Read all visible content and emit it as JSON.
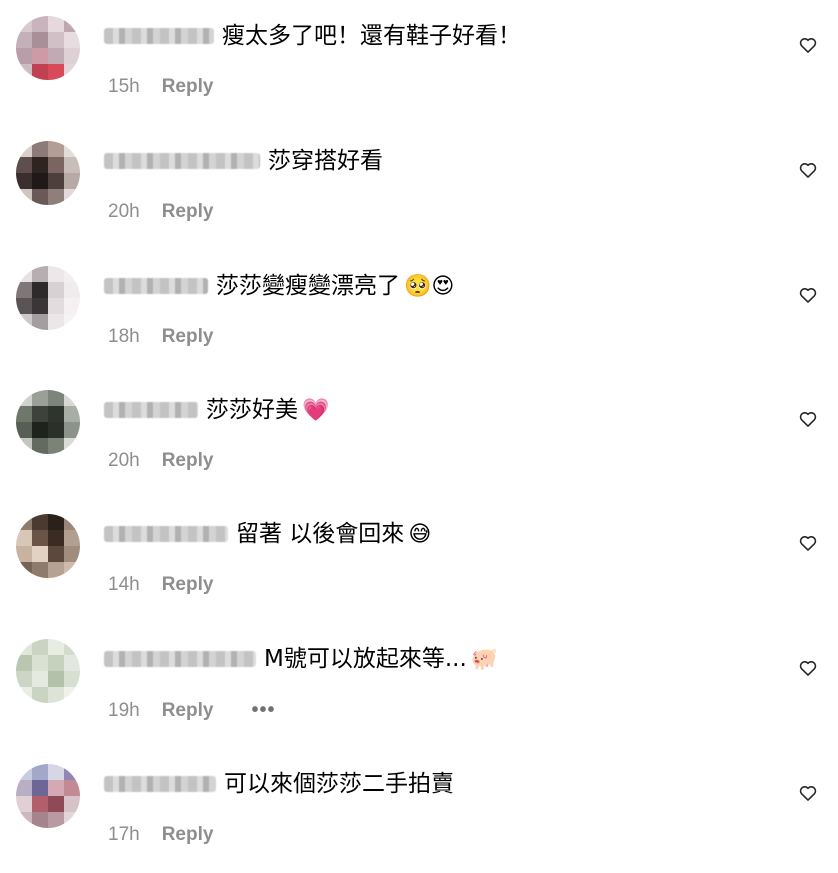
{
  "colors": {
    "text": "#000000",
    "meta": "#8e8e8e",
    "heart_stroke": "#262626"
  },
  "comments": [
    {
      "text": "瘦太多了吧！還有鞋子好看！",
      "emoji": "",
      "time": "15h",
      "reply": "Reply",
      "more": "",
      "avatar_colors": [
        "#d8c9cf",
        "#c9b3bc",
        "#e6d8dc",
        "#bfa7b0",
        "#c4b0b8",
        "#a88f98",
        "#d1c0c6",
        "#e7dde0",
        "#b79ea8",
        "#ce9aa6",
        "#c2aab4",
        "#dfd0d5",
        "#cdbcc3",
        "#c04252",
        "#d84a5a",
        "#e2d6da"
      ]
    },
    {
      "text": "莎穿搭好看",
      "emoji": "",
      "time": "20h",
      "reply": "Reply",
      "more": "",
      "avatar_colors": [
        "#d9d0cc",
        "#8e7b77",
        "#b39d96",
        "#e4dcd9",
        "#5f4e4b",
        "#2e2523",
        "#7a6560",
        "#c9bdb9",
        "#3a2f2d",
        "#1f1a19",
        "#4c3f3c",
        "#b7a9a4",
        "#cfc5c2",
        "#6a5a57",
        "#8f7f7b",
        "#e1dad8"
      ]
    },
    {
      "text": "莎莎變瘦變漂亮了",
      "emoji": "🥺😍",
      "time": "18h",
      "reply": "Reply",
      "more": "",
      "avatar_colors": [
        "#e6e2e3",
        "#b6aeb0",
        "#ece8e9",
        "#f3eef0",
        "#7f7678",
        "#2c2a2b",
        "#d8d1d3",
        "#f0ebec",
        "#5a5456",
        "#3a3637",
        "#e3dcde",
        "#f5f1f2",
        "#cfc8ca",
        "#a59ea0",
        "#ebe6e7",
        "#f6f3f4"
      ]
    },
    {
      "text": "莎莎好美",
      "emoji": "💗",
      "time": "20h",
      "reply": "Reply",
      "more": "",
      "avatar_colors": [
        "#cfd3cd",
        "#9aa096",
        "#7d8479",
        "#d7dad3",
        "#6f776b",
        "#3d433a",
        "#2f342d",
        "#a9aea5",
        "#575e54",
        "#1f231e",
        "#2b302a",
        "#8c9388",
        "#c3c7bf",
        "#636a60",
        "#7b8277",
        "#d9dcd5"
      ]
    },
    {
      "text": "留著 以後會回來",
      "emoji": "😅",
      "time": "14h",
      "reply": "Reply",
      "more": "",
      "avatar_colors": [
        "#8d7b6e",
        "#4b3a30",
        "#2b211b",
        "#9a8779",
        "#d8c7b6",
        "#6b5445",
        "#3a2c23",
        "#b39f8f",
        "#c8b3a1",
        "#e2d2c3",
        "#5c483c",
        "#a18d7e",
        "#766356",
        "#8f7b6c",
        "#b6a292",
        "#cdbcae"
      ]
    },
    {
      "text": "M號可以放起來等...",
      "emoji": "🐖",
      "time": "19h",
      "reply": "Reply",
      "more": "•••",
      "avatar_colors": [
        "#dfe6da",
        "#c9d4c2",
        "#e8ede4",
        "#d3dccc",
        "#b9c6b0",
        "#d9e1d3",
        "#c6d1be",
        "#e2e8dd",
        "#cdd6c6",
        "#e5eae0",
        "#b3c0aa",
        "#d7dfd1",
        "#e9eee5",
        "#cad4c3",
        "#dde4d7",
        "#eef2eb"
      ]
    },
    {
      "text": "可以來個莎莎二手拍賣",
      "emoji": "",
      "time": "17h",
      "reply": "Reply",
      "more": "",
      "avatar_colors": [
        "#c9cbe0",
        "#a3a7c9",
        "#d6d6e6",
        "#8f86b3",
        "#b9aec4",
        "#6c6797",
        "#d3a9b3",
        "#c28a93",
        "#e0cfd4",
        "#b05f6b",
        "#8e4b57",
        "#d6c3c8",
        "#cbb7bd",
        "#a5848d",
        "#b99aa2",
        "#e3d6da"
      ]
    }
  ]
}
